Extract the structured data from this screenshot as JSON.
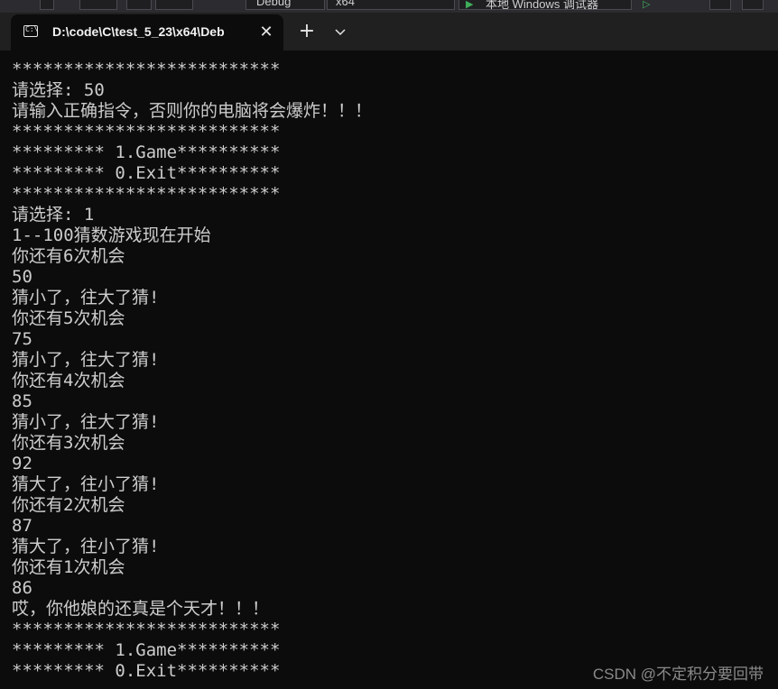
{
  "background_app": {
    "visible_text": [
      "Debug",
      "x64",
      "本地 Windows 调试器"
    ]
  },
  "tab": {
    "icon": "command-prompt-icon",
    "title": "D:\\code\\C\\test_5_23\\x64\\Deb",
    "close_icon": "close-icon"
  },
  "titlebar": {
    "new_tab_icon": "plus-icon",
    "dropdown_icon": "chevron-down-icon"
  },
  "console": {
    "lines": [
      "**************************",
      "请选择: 50",
      "请输入正确指令，否则你的电脑将会爆炸！！！",
      "**************************",
      "********* 1.Game**********",
      "********* 0.Exit**********",
      "**************************",
      "请选择: 1",
      "1--100猜数游戏现在开始",
      "你还有6次机会",
      "50",
      "猜小了，往大了猜!",
      "你还有5次机会",
      "75",
      "猜小了，往大了猜!",
      "你还有4次机会",
      "85",
      "猜小了，往大了猜!",
      "你还有3次机会",
      "92",
      "猜大了，往小了猜!",
      "你还有2次机会",
      "87",
      "猜大了，往小了猜!",
      "你还有1次机会",
      "86",
      "哎，你他娘的还真是个天才！！！",
      "**************************",
      "********* 1.Game**********",
      "********* 0.Exit**********"
    ]
  },
  "watermark": "CSDN @不定积分要回带",
  "colors": {
    "console_background": "#0c0c0c",
    "titlebar_background": "#202020",
    "console_text": "#cccccc",
    "tab_text": "#f2f2f2",
    "watermark_text": "#8a8a8a"
  }
}
